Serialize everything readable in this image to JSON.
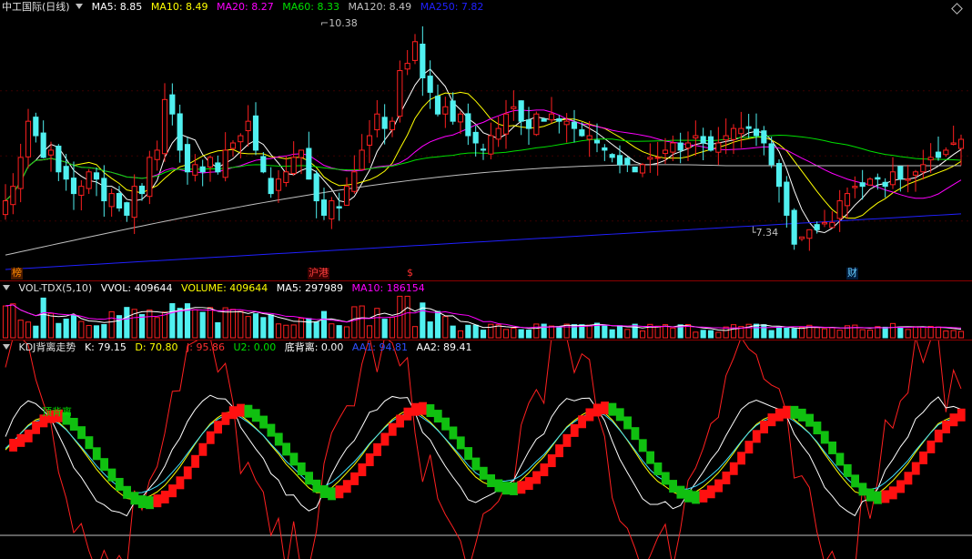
{
  "main": {
    "title": "中工国际(日线)",
    "indicators": [
      {
        "label": "MA5: 8.85",
        "color": "#ffffff"
      },
      {
        "label": "MA10: 8.49",
        "color": "#ffff00"
      },
      {
        "label": "MA20: 8.27",
        "color": "#ff00ff"
      },
      {
        "label": "MA60: 8.33",
        "color": "#00e000"
      },
      {
        "label": "MA120: 8.49",
        "color": "#c0c0c0"
      },
      {
        "label": "MA250: 7.82",
        "color": "#2020ff"
      }
    ],
    "high_label": "10.38",
    "low_label": "7.34",
    "events": [
      {
        "text": "榜",
        "color": "#ff8c00",
        "bg": "#4a1a00"
      },
      {
        "text": "沪港",
        "color": "#ff4040",
        "bg": "#3a0000"
      },
      {
        "text": "$",
        "color": "#ff3030",
        "bg": "#000"
      },
      {
        "text": "财",
        "color": "#66ccff",
        "bg": "#001a3a"
      }
    ]
  },
  "vol": {
    "title": "VOL-TDX(5,10)",
    "indicators": [
      {
        "label": "VVOL: 409644",
        "color": "#ffffff"
      },
      {
        "label": "VOLUME: 409644",
        "color": "#ffff00"
      },
      {
        "label": "MA5: 297989",
        "color": "#ffffff"
      },
      {
        "label": "MA10: 186154",
        "color": "#ff00ff"
      }
    ]
  },
  "kdj": {
    "title": "KDJ背离走势",
    "indicators": [
      {
        "label": "K: 79.15",
        "color": "#ffffff"
      },
      {
        "label": "D: 70.80",
        "color": "#ffff00"
      },
      {
        "label": "J: 95.86",
        "color": "#ff3030"
      },
      {
        "label": "U2: 0.00",
        "color": "#00e000"
      },
      {
        "label": "底背离: 0.00",
        "color": "#ffffff"
      },
      {
        "label": "AA1: 94.81",
        "color": "#3050ff"
      },
      {
        "label": "AA2: 89.41",
        "color": "#ffffff"
      }
    ],
    "annotation": "顶背离"
  },
  "colors": {
    "up": "#ff2020",
    "down": "#50f0f0",
    "sep": "#8b0000"
  },
  "chart_data": {
    "type": "candlestick",
    "price_range": [
      7.0,
      10.6
    ],
    "high": 10.38,
    "low": 7.34,
    "last": {
      "MA5": 8.85,
      "MA10": 8.49,
      "MA20": 8.27,
      "MA60": 8.33,
      "MA120": 8.49,
      "MA250": 7.82
    },
    "closes": [
      8.0,
      8.2,
      8.6,
      9.1,
      8.9,
      8.6,
      8.7,
      8.4,
      8.3,
      8.1,
      8.2,
      8.4,
      8.3,
      8.0,
      8.1,
      7.9,
      7.8,
      8.2,
      8.1,
      8.6,
      8.7,
      9.4,
      9.2,
      8.7,
      8.4,
      8.5,
      8.4,
      8.6,
      8.4,
      8.7,
      8.8,
      8.9,
      9.1,
      8.7,
      8.4,
      8.1,
      8.3,
      8.4,
      8.6,
      8.7,
      8.3,
      8.0,
      7.8,
      8.0,
      7.9,
      8.2,
      8.4,
      8.7,
      8.9,
      9.2,
      9.0,
      9.1,
      9.8,
      9.9,
      10.2,
      9.7,
      9.5,
      9.2,
      9.3,
      9.1,
      9.2,
      8.9,
      8.8,
      8.7,
      8.9,
      9.0,
      9.2,
      9.3,
      9.1,
      9.0,
      9.2,
      9.1,
      9.2,
      9.1,
      9.1,
      9.0,
      8.9,
      8.9,
      8.8,
      8.7,
      8.6,
      8.5,
      8.5,
      8.4,
      8.5,
      8.6,
      8.6,
      8.7,
      8.8,
      8.7,
      8.8,
      8.9,
      8.8,
      8.7,
      8.8,
      8.9,
      9.0,
      9.0,
      9.0,
      8.9,
      8.8,
      8.5,
      8.2,
      7.8,
      7.4,
      7.5,
      7.6,
      7.6,
      7.7,
      7.7,
      8.0,
      8.1,
      8.2,
      8.2,
      8.3,
      8.3,
      8.2,
      8.4,
      8.3,
      8.3,
      8.4,
      8.5,
      8.6,
      8.6,
      8.7,
      8.8,
      8.85
    ],
    "volume": {
      "last": 409644,
      "ma5": 297989,
      "ma10": 186154
    },
    "kdj": {
      "K": 79.15,
      "D": 70.8,
      "J": 95.86,
      "U2": 0.0,
      "bottom_divergence": 0.0,
      "AA1": 94.81,
      "AA2": 89.41
    }
  }
}
